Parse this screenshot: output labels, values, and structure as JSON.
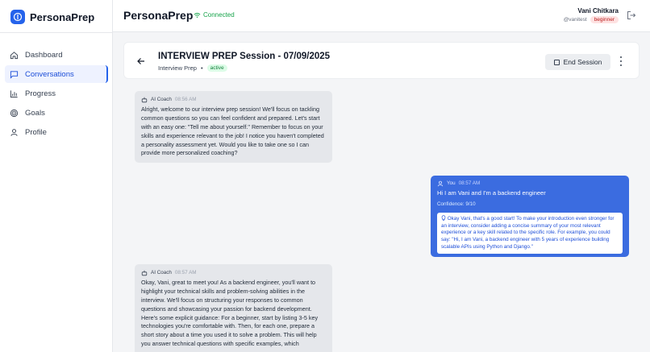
{
  "app": {
    "name": "PersonaPrep",
    "connection": "Connected"
  },
  "sidebar": {
    "items": [
      {
        "label": "Dashboard",
        "icon": "home-icon"
      },
      {
        "label": "Conversations",
        "icon": "chat-icon",
        "active": true
      },
      {
        "label": "Progress",
        "icon": "bar-chart-icon"
      },
      {
        "label": "Goals",
        "icon": "target-icon"
      },
      {
        "label": "Profile",
        "icon": "user-icon"
      }
    ]
  },
  "user": {
    "name": "Vani Chitkara",
    "handle": "@vanitest",
    "level": "beginner"
  },
  "session": {
    "title": "INTERVIEW PREP Session - 07/09/2025",
    "type": "Interview Prep",
    "separator": "•",
    "status": "active",
    "end_label": "End Session"
  },
  "messages": [
    {
      "sender": "AI Coach",
      "time": "08:56 AM",
      "text": "Alright, welcome to our interview prep session! We'll focus on tackling common questions so you can feel confident and prepared. Let's start with an easy one: \"Tell me about yourself.\" Remember to focus on your skills and experience relevant to the job! I notice you haven't completed a personality assessment yet. Would you like to take one so I can provide more personalized coaching?"
    },
    {
      "sender": "You",
      "time": "08:57 AM",
      "text": "Hi I am Vani and I'm a backend engineer",
      "confidence": "Confidence: 9/10",
      "feedback": "Okay Vani, that's a good start! To make your introduction even stronger for an interview, consider adding a concise summary of your most relevant experience or a key skill related to the specific role. For example, you could say: \"Hi, I am Vani, a backend engineer with 5 years of experience building scalable APIs using Python and Django.\""
    },
    {
      "sender": "AI Coach",
      "time": "08:57 AM",
      "text": "Okay, Vani, great to meet you! As a backend engineer, you'll want to highlight your technical skills and problem-solving abilities in the interview. We'll focus on structuring your responses to common questions and showcasing your passion for backend development. Here's some explicit guidance: For a beginner, start by listing 3-5 key technologies you're comfortable with. Then, for each one, prepare a short story about a time you used it to solve a problem. This will help you answer technical questions with specific examples, which"
    }
  ],
  "colors": {
    "accent": "#2563eb",
    "user_bubble": "#3b6ce0",
    "ai_bubble": "#e5e7eb",
    "connected": "#16a34a",
    "active_badge": "#dcfce7",
    "level_badge": "#fee2e2"
  }
}
